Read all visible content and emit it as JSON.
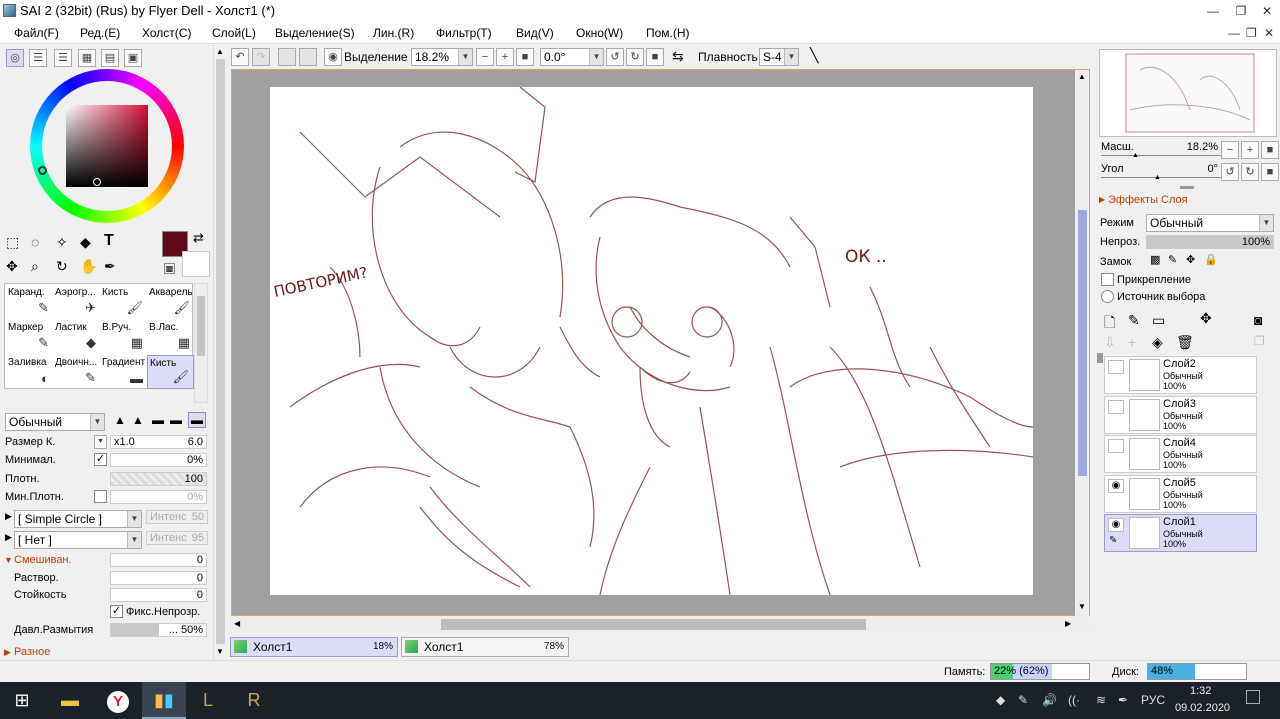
{
  "app": {
    "title": "SAI 2 (32bit) (Rus) by Flyer Dell - Холст1 (*)"
  },
  "menu": [
    "Файл(F)",
    "Ред.(E)",
    "Холст(C)",
    "Слой(L)",
    "Выделение(S)",
    "Лин.(R)",
    "Фильтр(T)",
    "Вид(V)",
    "Окно(W)",
    "Пом.(H)"
  ],
  "toolbar": {
    "selection_label": "Выделение",
    "zoom": "18.2%",
    "angle": "0.0°",
    "smooth_label": "Плавность",
    "smooth": "S-4"
  },
  "tools": {
    "cells": [
      {
        "label": "Каранд.",
        "icon": "✎"
      },
      {
        "label": "Аэрогр...",
        "icon": "✈"
      },
      {
        "label": "Кисть",
        "icon": "🖌"
      },
      {
        "label": "Акварель",
        "icon": "🖌"
      },
      {
        "label": "Маркер",
        "icon": "✎"
      },
      {
        "label": "Ластик",
        "icon": "◆"
      },
      {
        "label": "В.Руч.",
        "icon": "▦"
      },
      {
        "label": "В.Лас.",
        "icon": "▦"
      },
      {
        "label": "Заливка",
        "icon": "◐"
      },
      {
        "label": "Двоичн...",
        "icon": "✎"
      },
      {
        "label": "Градиент",
        "icon": "▬"
      },
      {
        "label": "Кисть",
        "icon": "🖌"
      }
    ]
  },
  "brush": {
    "mode": "Обычный",
    "size_label": "Размер К.",
    "size_mult": "x1.0",
    "size_val": "6.0",
    "min_label": "Минимал.",
    "min_val": "0%",
    "density_label": "Плотн.",
    "density_val": "100",
    "mindensity_label": "Мин.Плотн.",
    "mindensity_val": "0%",
    "shape": "[ Simple Circle ]",
    "shape_int_label": "Интенс",
    "shape_int_val": "50",
    "texture": "[ Нет ]",
    "tex_int_label": "Интенс",
    "tex_int_val": "95",
    "blend_label": "Смешиван.",
    "blend_val": "0",
    "dilution_label": "Раствор.",
    "dilution_val": "0",
    "persistence_label": "Стойкость",
    "persistence_val": "0",
    "keep_opacity_label": "Фикс.Непрозр.",
    "blur_label": "Давл.Размытия",
    "blur_val": "... 50%",
    "misc_label": "Разное"
  },
  "canvas": {
    "text1": "ПОВТОРИМ?",
    "text2": "ОК .."
  },
  "tabs": [
    {
      "name": "Холст1",
      "zoom": "18%"
    },
    {
      "name": "Холст1",
      "zoom": "78%"
    }
  ],
  "navigator": {
    "zoom_label": "Масш.",
    "zoom_val": "18.2%",
    "angle_label": "Угол",
    "angle_val": "0°"
  },
  "layer_effects": {
    "title": "Эффекты Слоя",
    "mode_label": "Режим",
    "mode_val": "Обычный",
    "opacity_label": "Непроз.",
    "opacity_val": "100%",
    "lock_label": "Замок",
    "clip_label": "Прикрепление",
    "source_label": "Источник выбора"
  },
  "layers": [
    {
      "name": "Слой2",
      "mode": "Обычный",
      "opacity": "100%",
      "visible": false
    },
    {
      "name": "Слой3",
      "mode": "Обычный",
      "opacity": "100%",
      "visible": false
    },
    {
      "name": "Слой4",
      "mode": "Обычный",
      "opacity": "100%",
      "visible": false
    },
    {
      "name": "Слой5",
      "mode": "Обычный",
      "opacity": "100%",
      "visible": true
    },
    {
      "name": "Слой1",
      "mode": "Обычный",
      "opacity": "100%",
      "visible": true,
      "selected": true
    }
  ],
  "status": {
    "memory_label": "Память:",
    "memory_val": "22% (62%)",
    "memory_pct": 0.22,
    "disk_label": "Диск:",
    "disk_val": "48%",
    "disk_pct": 0.48
  },
  "taskbar": {
    "lang": "РУС",
    "time": "1:32",
    "date": "09.02.2020"
  },
  "colors": {
    "primary": "#5e0a1a",
    "accent": "#dcdcf8"
  }
}
